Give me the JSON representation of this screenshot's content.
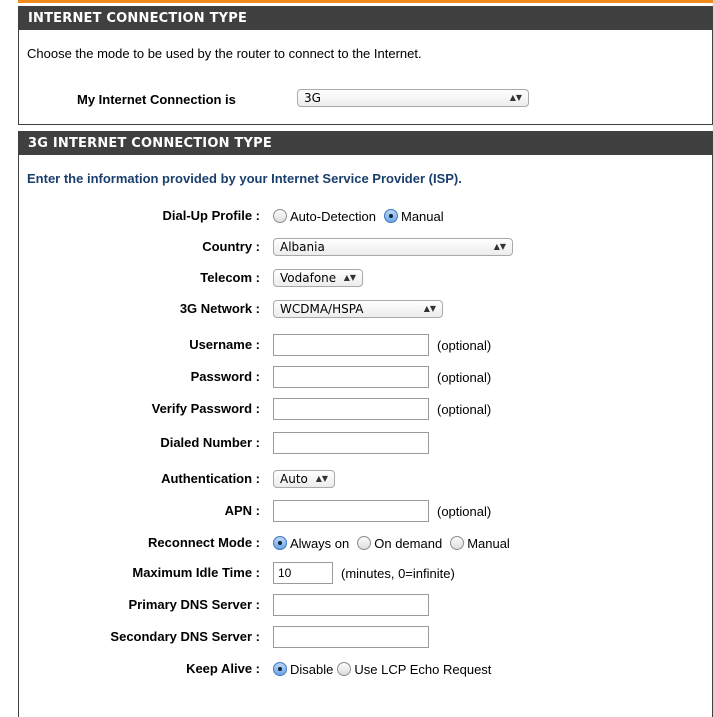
{
  "section1": {
    "title": "INTERNET CONNECTION TYPE",
    "intro": "Choose the mode to be used by the router to connect to the Internet.",
    "label": "My Internet Connection is",
    "value": "3G"
  },
  "section2": {
    "title": "3G INTERNET CONNECTION TYPE",
    "intro": "Enter the information provided by your Internet Service Provider (ISP).",
    "dialup": {
      "label": "Dial-Up Profile :",
      "opt1": "Auto-Detection",
      "opt2": "Manual",
      "selected": "Manual"
    },
    "country": {
      "label": "Country :",
      "value": "Albania"
    },
    "telecom": {
      "label": "Telecom :",
      "value": "Vodafone"
    },
    "network": {
      "label": "3G Network :",
      "value": "WCDMA/HSPA"
    },
    "username": {
      "label": "Username :",
      "value": "",
      "note": "(optional)"
    },
    "password": {
      "label": "Password :",
      "value": "",
      "note": "(optional)"
    },
    "verify": {
      "label": "Verify Password :",
      "value": "",
      "note": "(optional)"
    },
    "dialed": {
      "label": "Dialed Number :",
      "value": ""
    },
    "auth": {
      "label": "Authentication :",
      "value": "Auto"
    },
    "apn": {
      "label": "APN :",
      "value": "",
      "note": "(optional)"
    },
    "reconnect": {
      "label": "Reconnect Mode :",
      "opt1": "Always on",
      "opt2": "On demand",
      "opt3": "Manual",
      "selected": "Always on"
    },
    "idle": {
      "label": "Maximum Idle Time :",
      "value": "10",
      "note": "(minutes, 0=infinite)"
    },
    "dns1": {
      "label": "Primary DNS Server :",
      "value": ""
    },
    "dns2": {
      "label": "Secondary DNS Server :",
      "value": ""
    },
    "keepalive": {
      "label": "Keep Alive :",
      "opt1": "Disable",
      "opt2": "Use LCP Echo Request",
      "selected": "Disable"
    }
  },
  "colors": {
    "accent": "#f08a1c",
    "header_bg": "#404040",
    "intro_text": "#1a3f6d"
  },
  "icons": {
    "select_arrow": "updown-arrow-icon"
  }
}
